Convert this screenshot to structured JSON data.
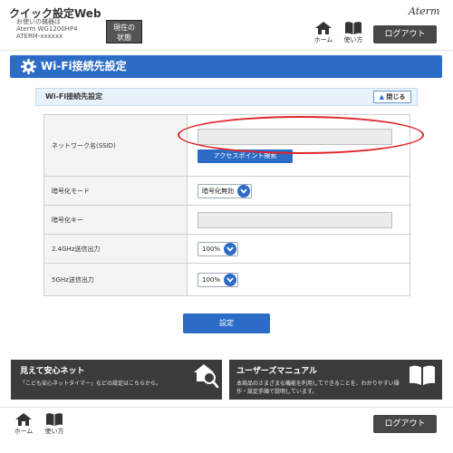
{
  "header": {
    "app_title": "クイック設定Web",
    "device_label": "お使いの機器は",
    "device_model": "Aterm WG1200HP4",
    "device_id": "ATERM-xxxxxx",
    "status_button_line1": "現在の",
    "status_button_line2": "状態",
    "brand": "Aterm",
    "home_label": "ホーム",
    "manual_label": "使い方",
    "logout_label": "ログアウト"
  },
  "section": {
    "title": "Wi-Fi接続先設定",
    "subtitle": "Wi-Fi接続先設定",
    "close_label": "閉じる"
  },
  "form": {
    "ssid_label": "ネットワーク名(SSID)",
    "ssid_value": "",
    "ap_search_label": "アクセスポイント検索",
    "encryption_label": "暗号化モード",
    "encryption_value": "暗号化無効",
    "key_label": "暗号化キー",
    "key_value": "",
    "power24_label": "2.4GHz送信出力",
    "power24_value": "100%",
    "power5_label": "5GHz送信出力",
    "power5_value": "100%",
    "submit_label": "設定"
  },
  "promos": {
    "left_title": "見えて安心ネット",
    "left_desc": "「こども安心ネットタイマー」などの設定はこちらから。",
    "right_title": "ユーザーズマニュアル",
    "right_desc": "本商品のさまざまな機能を利用してできることを、わかりやすい操作・設定手順で説明しています。"
  },
  "footer": {
    "home_label": "ホーム",
    "manual_label": "使い方",
    "logout_label": "ログアウト"
  },
  "colors": {
    "accent": "#2d6cc6",
    "dark": "#474747",
    "highlight": "#e0262a"
  }
}
